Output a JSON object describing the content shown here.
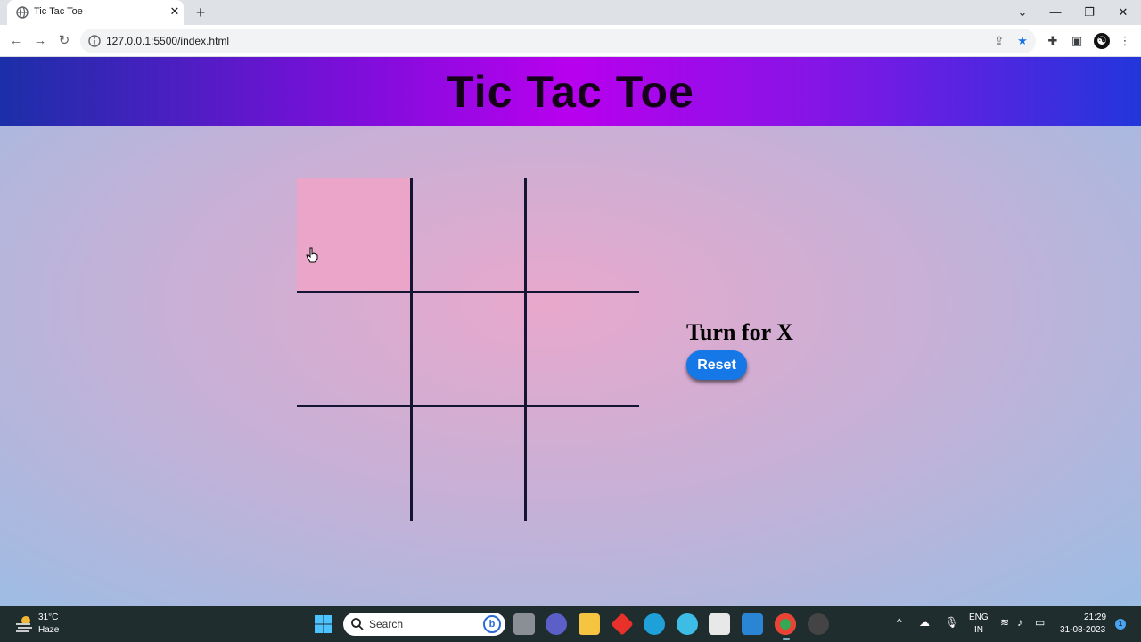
{
  "browser": {
    "tab_title": "Tic Tac Toe",
    "tab_close": "✕",
    "new_tab": "+",
    "url": "127.0.0.1:5500/index.html",
    "window_controls": {
      "dropdown": "⌄",
      "minimize": "—",
      "restore": "❐",
      "close": "✕"
    }
  },
  "page": {
    "title": "Tic Tac Toe",
    "turn_text": "Turn for X",
    "reset_label": "Reset",
    "board": [
      "",
      "",
      "",
      "",
      "",
      "",
      "",
      "",
      ""
    ],
    "hovered_cell": 0
  },
  "taskbar": {
    "weather_temp": "31°C",
    "weather_cond": "Haze",
    "search_placeholder": "Search",
    "lang_line1": "ENG",
    "lang_line2": "IN",
    "time": "21:29",
    "date": "31-08-2023",
    "notification_count": "1"
  },
  "colors": {
    "header_center": "#b800ee",
    "header_edge": "#1b2fa8",
    "reset_button": "#1677e6",
    "board_lines": "#141433",
    "hover_cell": "#eba5c9"
  }
}
